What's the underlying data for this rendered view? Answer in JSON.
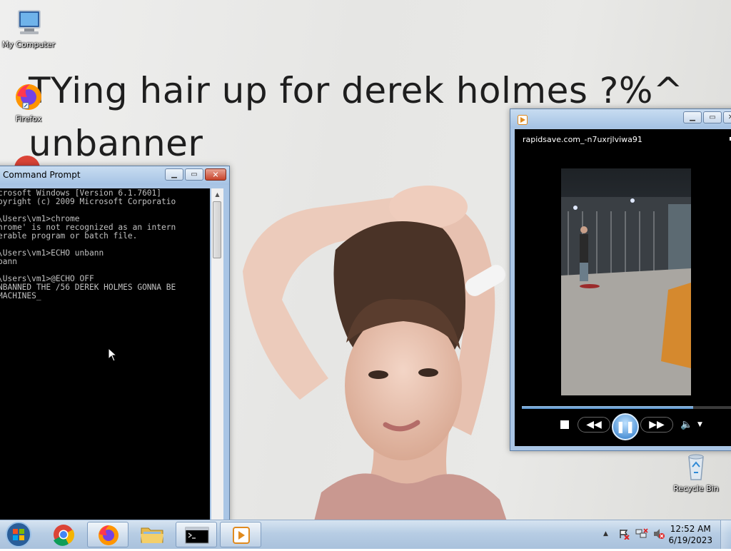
{
  "wallpaper": {
    "headline_line1": "TYing hair up for derek holmes ?%^",
    "headline_line2": "unbanner"
  },
  "desktop_icons": {
    "my_computer": "My Computer",
    "firefox": "Firefox",
    "recycle_bin": "Recycle Bin"
  },
  "cmd": {
    "title": "Command Prompt",
    "lines": "crosoft Windows [Version 6.1.7601]\npyright (c) 2009 Microsoft Corporatio\n\n\\Users\\vm1>chrome\nhrome' is not recognized as an intern\nerable program or batch file.\n\n\\Users\\vm1>ECHO unbann\nbann\n\n\\Users\\vm1>@ECHO OFF\nNBANNED THE /56 DEREK HOLMES GONNA BE\nMACHINES_"
  },
  "media": {
    "title": "rapidsave.com_-n7uxrjlviwa91",
    "progress_fraction": 0.8
  },
  "taskbar": {
    "time": "12:52 AM",
    "date": "6/19/2023"
  },
  "colors": {
    "taskbar": "#b7cde4",
    "window_frame": "#a9c5e5",
    "console_bg": "#000000",
    "console_text": "#c0c0c0",
    "close_button": "#c7432a"
  }
}
